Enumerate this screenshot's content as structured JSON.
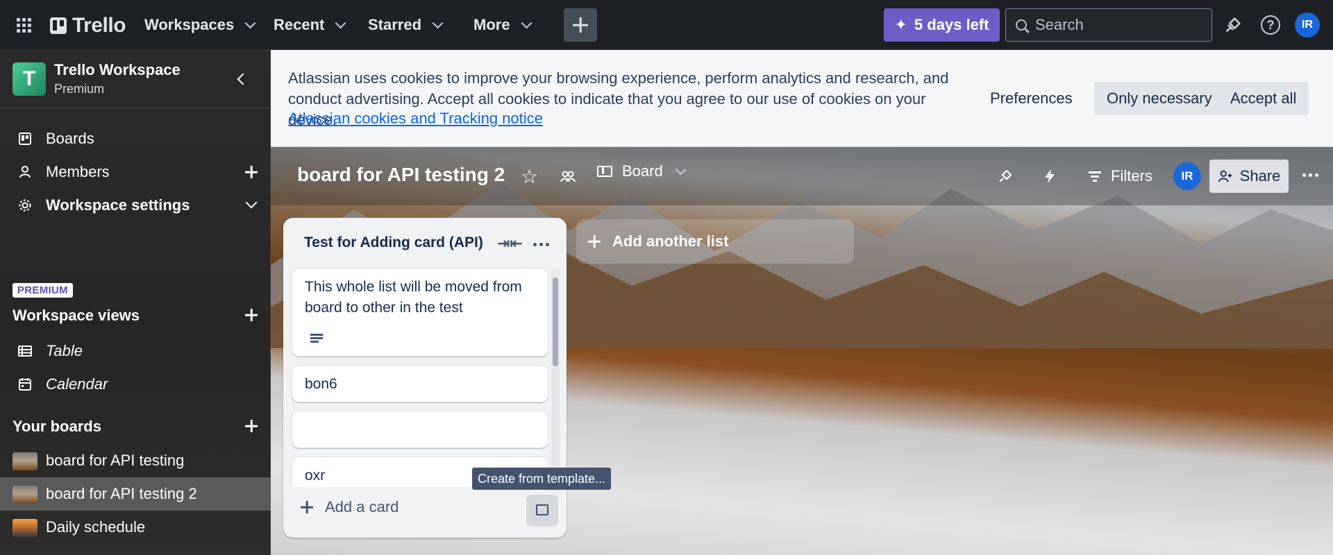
{
  "topnav": {
    "logo_text": "Trello",
    "menus": [
      "Workspaces",
      "Recent",
      "Starred",
      "More"
    ],
    "trial_label": "5 days left",
    "search_placeholder": "Search",
    "avatar_initials": "IR"
  },
  "sidebar": {
    "workspace_initial": "T",
    "workspace_name": "Trello Workspace",
    "workspace_plan": "Premium",
    "nav": [
      "Boards",
      "Members",
      "Workspace settings"
    ],
    "premium_badge": "PREMIUM",
    "views_title": "Workspace views",
    "views": [
      "Table",
      "Calendar"
    ],
    "boards_title": "Your boards",
    "boards": [
      "board for API testing",
      "board for API testing 2",
      "Daily schedule"
    ]
  },
  "cookie_banner": {
    "text": "Atlassian uses cookies to improve your browsing experience, perform analytics and research, and conduct advertising. Accept all cookies to indicate that you agree to our use of cookies on your device.",
    "link": "Atlassian cookies and Tracking notice",
    "preferences": "Preferences",
    "only_necessary": "Only necessary",
    "accept_all": "Accept all"
  },
  "board": {
    "title": "board for API testing 2",
    "view": "Board",
    "filters": "Filters",
    "avatar_initials": "IR",
    "share": "Share",
    "add_list": "Add another list"
  },
  "list": {
    "title": "Test for Adding card (API)",
    "cards": [
      "This whole list will be moved from board to other in the test",
      "bon6",
      "",
      "oxr"
    ],
    "add_card": "Add a card",
    "tooltip": "Create from template..."
  }
}
